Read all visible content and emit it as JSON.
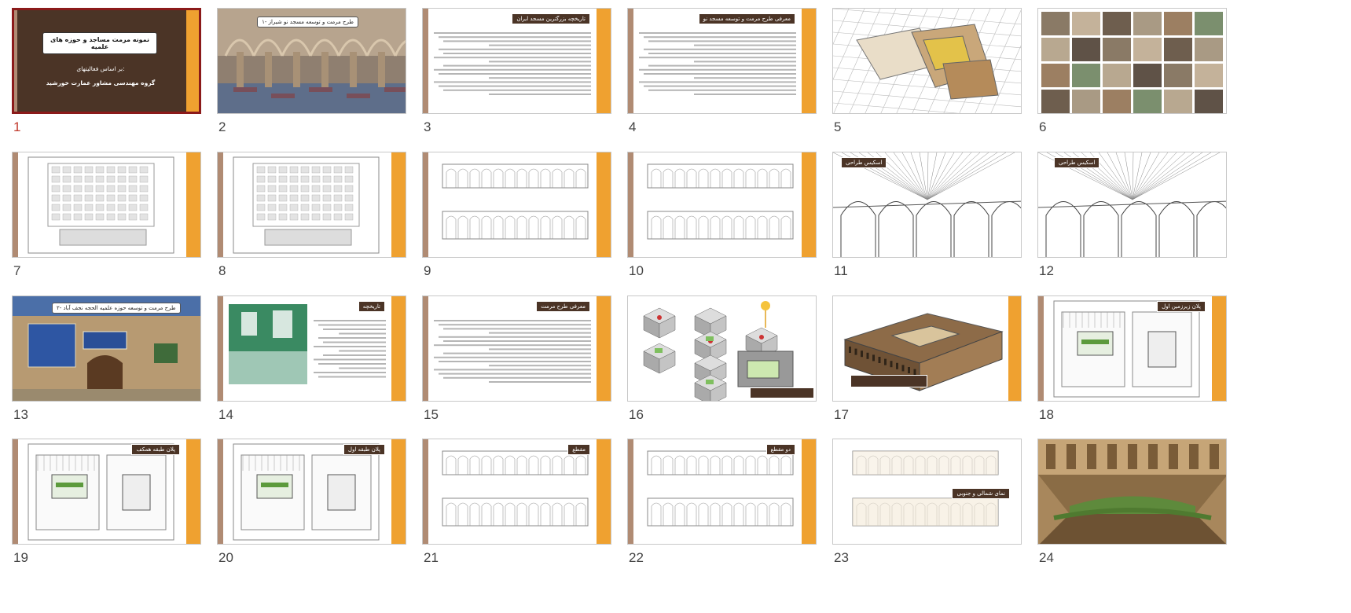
{
  "slides": [
    {
      "num": "1",
      "kind": "title",
      "selected": true,
      "title": "نمونه مرمت مساجد و حوزه های علمیه",
      "line1": "بر اساس فعالیتهای:",
      "line2": "گروه مهندسی مشاور عمارت خورشید"
    },
    {
      "num": "2",
      "kind": "photo-mosque",
      "tag": "۱- طرح مرمت و توسعه مسجد نو شیراز"
    },
    {
      "num": "3",
      "kind": "text",
      "tag": "تاریخچه بزرگترین مسجد ایران"
    },
    {
      "num": "4",
      "kind": "text",
      "tag": "معرفی طرح مرمت و توسعه مسجد نو"
    },
    {
      "num": "5",
      "kind": "aerial"
    },
    {
      "num": "6",
      "kind": "collage"
    },
    {
      "num": "7",
      "kind": "plan"
    },
    {
      "num": "8",
      "kind": "plan"
    },
    {
      "num": "9",
      "kind": "elevation"
    },
    {
      "num": "10",
      "kind": "elevation"
    },
    {
      "num": "11",
      "kind": "sketch",
      "tag": "اسکیس طراحی"
    },
    {
      "num": "12",
      "kind": "sketch",
      "tag": "اسکیس طراحی"
    },
    {
      "num": "13",
      "kind": "photo-hozeh",
      "tag": "۲- طرح مرمت و توسعه حوزه علمیه الحجه نجف آباد"
    },
    {
      "num": "14",
      "kind": "text-photo",
      "tag": "تاریخچه"
    },
    {
      "num": "15",
      "kind": "text",
      "tag": "معرفی طرح مرمت"
    },
    {
      "num": "16",
      "kind": "diagram"
    },
    {
      "num": "17",
      "kind": "render"
    },
    {
      "num": "18",
      "kind": "plan-color",
      "tag": "پلان زیرزمین اول"
    },
    {
      "num": "19",
      "kind": "plan-color",
      "tag": "پلان طبقه همکف"
    },
    {
      "num": "20",
      "kind": "plan-color",
      "tag": "پلان طبقه اول"
    },
    {
      "num": "21",
      "kind": "section",
      "tag": "مقطع"
    },
    {
      "num": "22",
      "kind": "section",
      "tag": "دو مقطع"
    },
    {
      "num": "23",
      "kind": "facade",
      "tag": "نمای شمالی و جنوبی"
    },
    {
      "num": "24",
      "kind": "courtyard"
    }
  ],
  "colors": {
    "brown": "#4b3426",
    "orange": "#efa130",
    "tan": "#b08b73",
    "selected_border": "#8b1a1a",
    "selected_number": "#c0392b"
  }
}
